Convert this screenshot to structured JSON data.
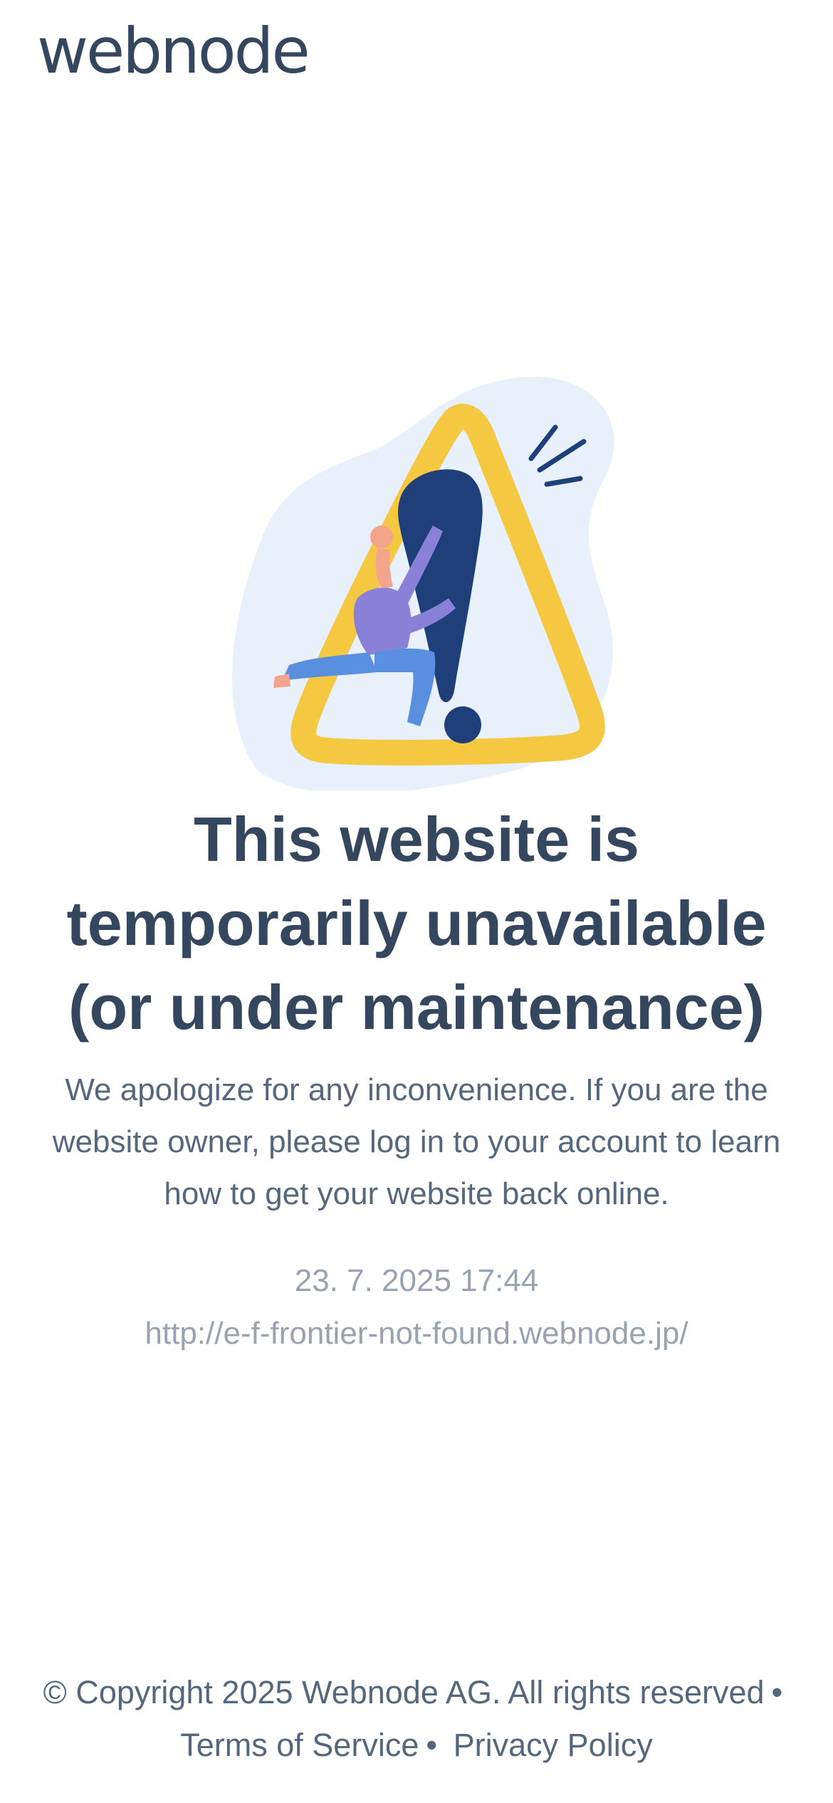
{
  "brand": {
    "logo_text": "webnode"
  },
  "illustration": {
    "icon": "warning-triangle-illustration"
  },
  "main": {
    "title": "This website is temporarily unavailable (or under maintenance)",
    "message": "We apologize for any inconvenience. If you are the website owner, please log in to your account to learn how to get your website back online.",
    "timestamp": "23. 7. 2025 17:44",
    "url": "http://e-f-frontier-not-found.webnode.jp/"
  },
  "footer": {
    "copyright": "© Copyright 2025 Webnode AG. All rights reserved",
    "separator": "•",
    "terms_label": "Terms of Service",
    "privacy_label": "Privacy Policy"
  },
  "colors": {
    "text": "#34475f",
    "muted": "#98a3b2",
    "accent_yellow": "#f5c842",
    "accent_navy": "#1f3f7a",
    "blob": "#e8f0fb"
  }
}
